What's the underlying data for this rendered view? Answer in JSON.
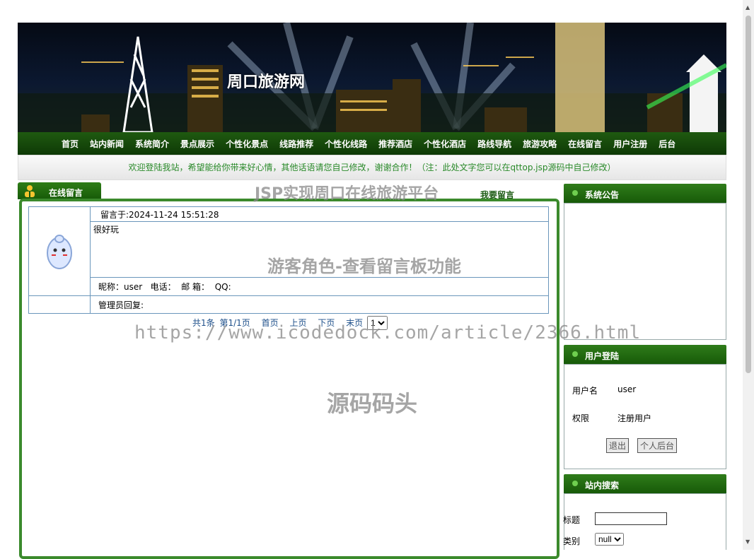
{
  "site": {
    "title": "周口旅游网"
  },
  "nav": [
    "首页",
    "站内新闻",
    "系统简介",
    "景点展示",
    "个性化景点",
    "线路推荐",
    "个性化线路",
    "推荐酒店",
    "个性化酒店",
    "路线导航",
    "旅游攻略",
    "在线留言",
    "用户注册",
    "后台"
  ],
  "welcome": "欢迎登陆我站，希望能给你带来好心情，其他话语请您自己修改，谢谢合作！（注：此处文字您可以在qttop.jsp源码中自己修改）",
  "main": {
    "tab_label": "在线留言",
    "write_link": "我要留言",
    "message": {
      "time": "留言于:2024-11-24 15:51:28",
      "content": "很好玩",
      "info": "昵称：user   电话：  邮 箱：  QQ:",
      "reply": "管理员回复:"
    },
    "pager": {
      "total": "共1条",
      "page": "第1/1页",
      "first": "首页",
      "prev": "上页",
      "next": "下页",
      "last": "末页",
      "selected": "1"
    }
  },
  "sidebar": {
    "notice_title": "系统公告",
    "login_title": "用户登陆",
    "username_label": "用户名",
    "username_value": "user",
    "role_label": "权限",
    "role_value": "注册用户",
    "logout_btn": "退出",
    "backend_btn": "个人后台",
    "search_title": "站内搜索",
    "search_title_label": "标题",
    "category_label": "类别",
    "category_value": "null"
  },
  "watermarks": {
    "top": "JSP实现周口在线旅游平台",
    "mid": "游客角色-查看留言板功能",
    "url": "https://www.icodedock.com/article/2366.html",
    "brand": "源码码头"
  }
}
